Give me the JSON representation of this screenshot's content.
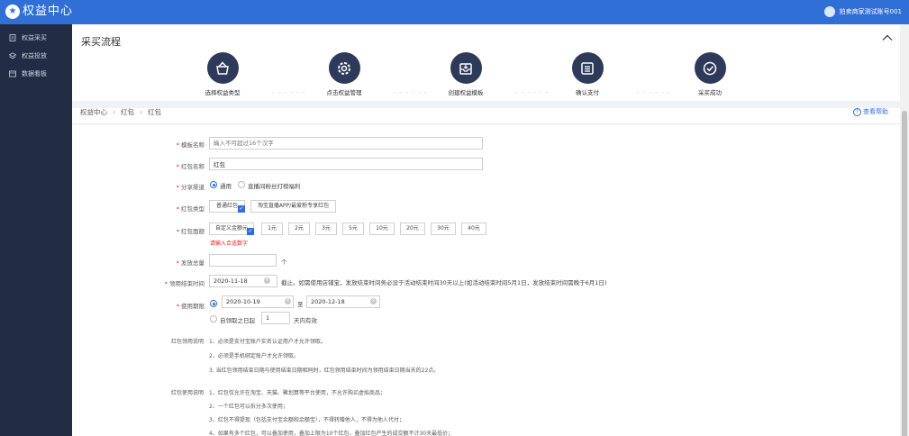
{
  "app": {
    "title": "权益中心",
    "account": "拍卖商家测试账号001"
  },
  "sidebar": {
    "items": [
      {
        "label": "权益采买",
        "icon": "document-icon"
      },
      {
        "label": "权益投放",
        "icon": "layers-icon"
      },
      {
        "label": "数据看板",
        "icon": "dashboard-icon"
      }
    ]
  },
  "flow": {
    "title": "采买流程",
    "steps": [
      {
        "label": "选择权益类型",
        "icon": "basket-icon"
      },
      {
        "label": "点击权益管理",
        "icon": "gear-icon"
      },
      {
        "label": "创建权益模板",
        "icon": "inbox-icon"
      },
      {
        "label": "确认支付",
        "icon": "list-icon"
      },
      {
        "label": "采买成功",
        "icon": "check-circle-icon"
      }
    ]
  },
  "breadcrumb": [
    "权益中心",
    "红包",
    "红包"
  ],
  "help_label": "查看帮助",
  "form": {
    "template_name": {
      "label": "模板名称",
      "placeholder": "输入不可超过16个汉字"
    },
    "redpack_name": {
      "label": "红包名称",
      "value": "红包"
    },
    "share_channel": {
      "label": "分享渠道",
      "options": [
        "通用",
        "直播间粉丝打榜福利"
      ]
    },
    "redpack_type": {
      "label": "红包类型",
      "options": [
        "普通红包",
        "淘宝直播APP/最爱粉专享红包"
      ]
    },
    "amount": {
      "label": "红包面额",
      "custom": "自定义金额元",
      "options": [
        "1元",
        "2元",
        "3元",
        "5元",
        "10元",
        "20元",
        "30元",
        "40元"
      ],
      "error": "请输入合适数字"
    },
    "total": {
      "label": "发放总量",
      "unit": "个"
    },
    "claim_end": {
      "label": "领用结束时间",
      "value": "2020-11-18",
      "hint": "截止。如需使用店铺宝，发放结束时间务必设于活动结束时间30天以上(如活动结束时间5月1日，发放结束时间需晚于6月1日)"
    },
    "validity": {
      "label": "使用期限",
      "start": "2020-10-19",
      "to": "至",
      "end": "2020-12-18",
      "relative_prefix": "自领取之日起",
      "days": "1",
      "relative_suffix": "天内有效"
    }
  },
  "claim_notes": {
    "title": "红包领用说明",
    "lines": [
      "1、必须是支付宝账户实名认证用户才允许领取。",
      "2、必须是手机绑定账户才允许领取。",
      "3. 当红包领用结束日期与使用结束日期相同时，红包领用结束时间为领用结束日期当天的22点。"
    ]
  },
  "usage_notes": {
    "title": "红包使用说明",
    "lines": [
      "1、红包仅允许在淘宝、天猫、聚划算等平台使用，不允许购买虚拟商品；",
      "2、一个红包可以拆分多次使用；",
      "3、红包不得提现（包括支付宝余额和余额宝），不得转赠他人，不得为他人代付；",
      "4、如果有多个红包，可以叠加使用，叠加上限为10个红包，叠加红包产生的成交额不计30天最低价；"
    ]
  },
  "colors": {
    "topbar": "#2f6fd6",
    "sidebar": "#222d45",
    "step_circle": "#2e3a59",
    "required": "#e02020"
  }
}
